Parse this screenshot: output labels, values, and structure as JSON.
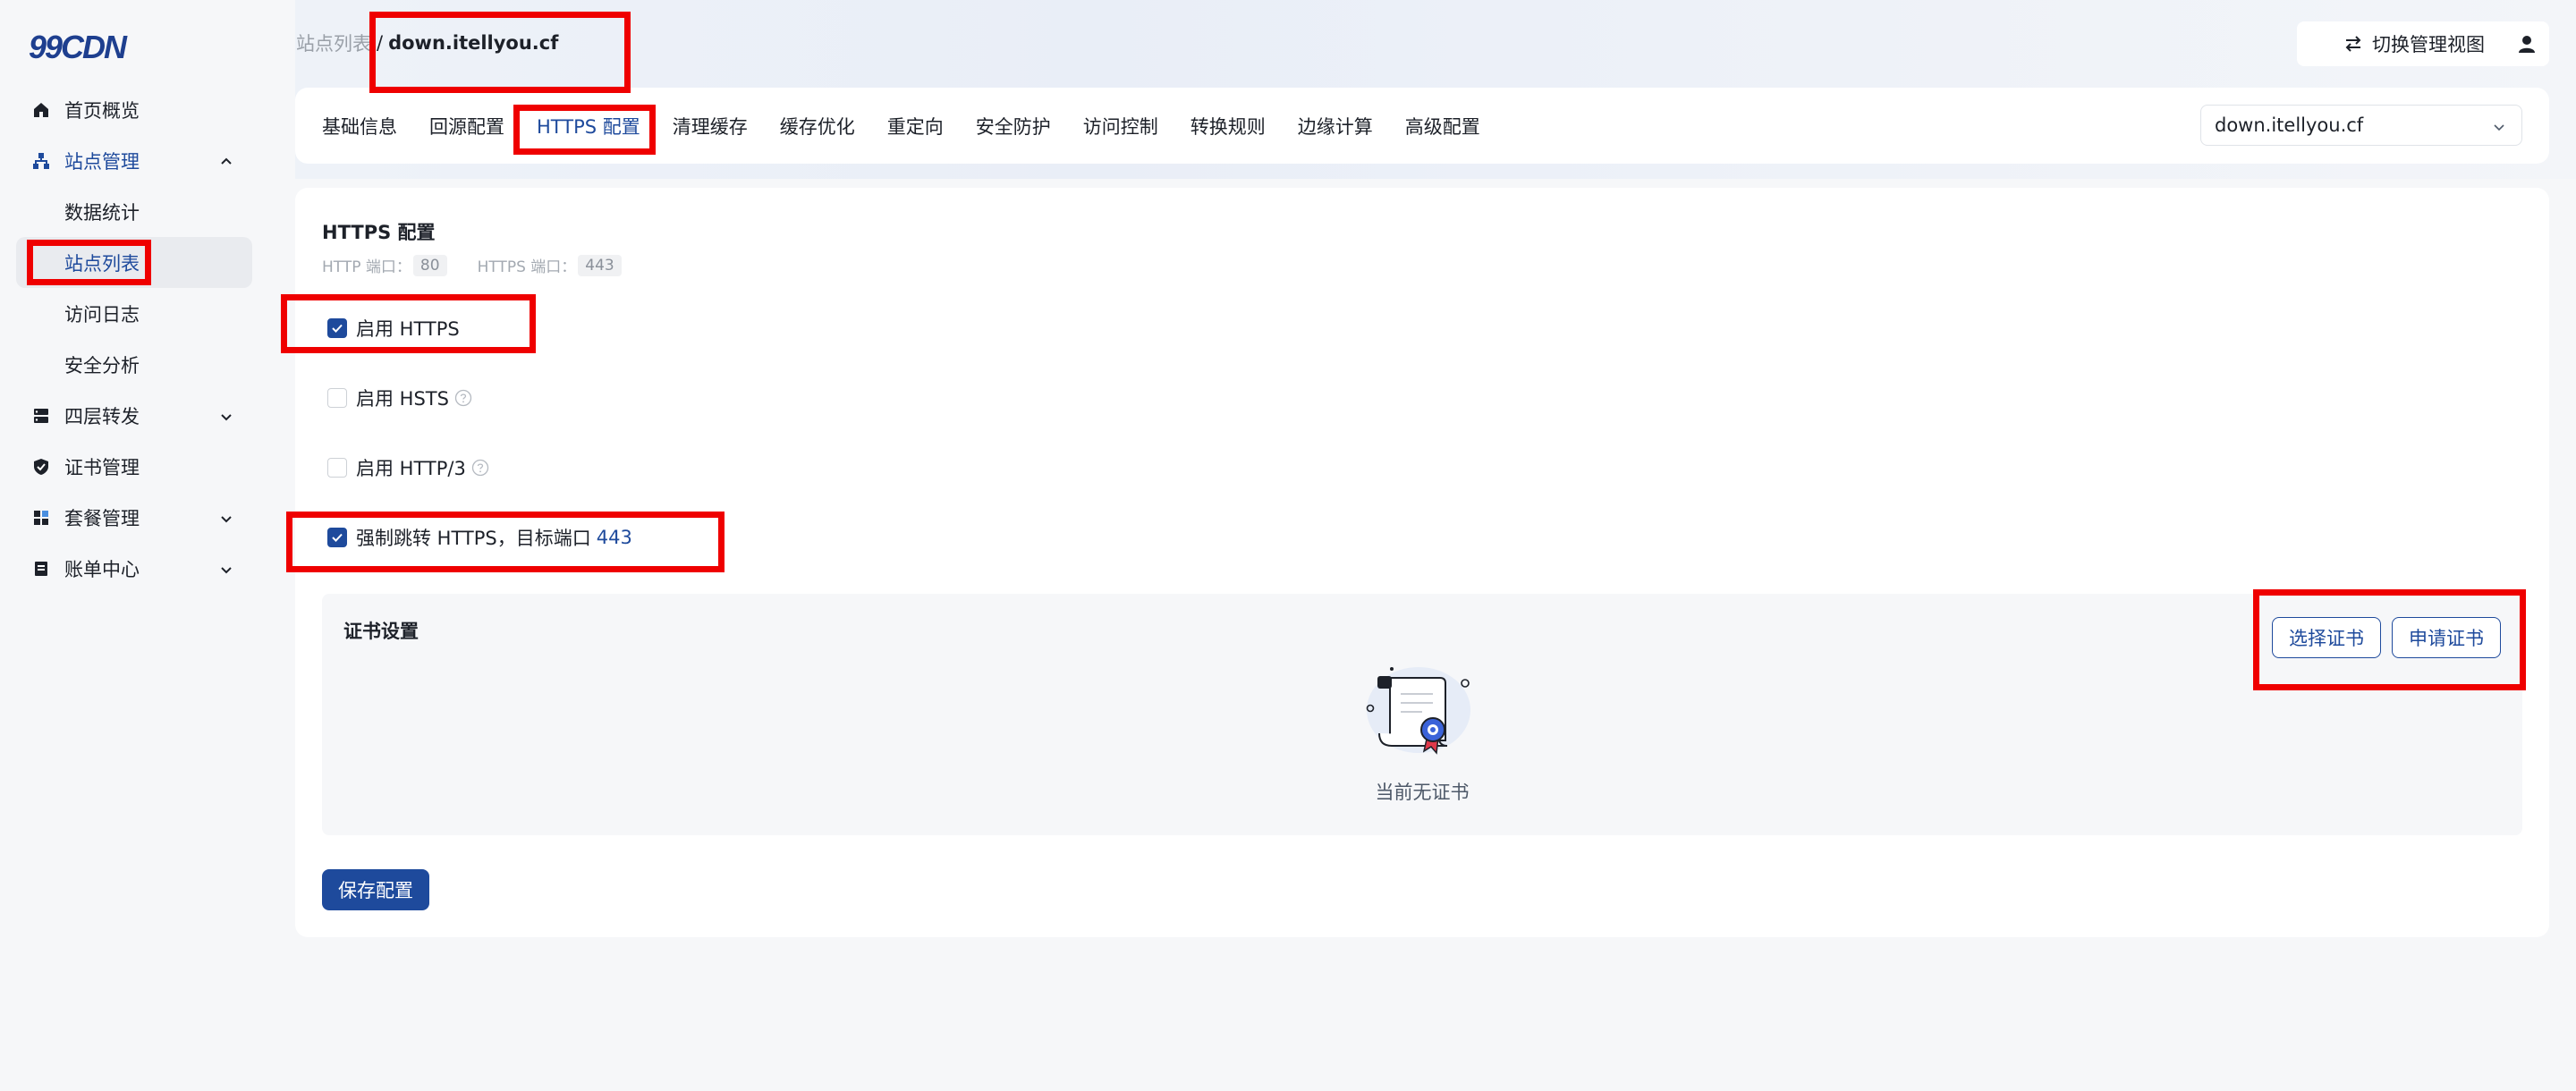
{
  "app": {
    "logo_text": "99CDN"
  },
  "sidebar": {
    "items": [
      {
        "label": "首页概览",
        "icon": "home-icon"
      },
      {
        "label": "站点管理",
        "icon": "sitemap-icon",
        "expanded": true
      },
      {
        "label": "数据统计"
      },
      {
        "label": "站点列表",
        "selected": true
      },
      {
        "label": "访问日志"
      },
      {
        "label": "安全分析"
      },
      {
        "label": "四层转发",
        "icon": "server-icon"
      },
      {
        "label": "证书管理",
        "icon": "shield-icon"
      },
      {
        "label": "套餐管理",
        "icon": "grid-icon"
      },
      {
        "label": "账单中心",
        "icon": "bill-icon"
      }
    ]
  },
  "header": {
    "breadcrumb_root": "站点列表",
    "breadcrumb_sep": "/",
    "breadcrumb_current": "down.itellyou.cf",
    "switch_view_label": "切换管理视图"
  },
  "tabs": [
    {
      "label": "基础信息"
    },
    {
      "label": "回源配置"
    },
    {
      "label": "HTTPS 配置",
      "active": true
    },
    {
      "label": "清理缓存"
    },
    {
      "label": "缓存优化"
    },
    {
      "label": "重定向"
    },
    {
      "label": "安全防护"
    },
    {
      "label": "访问控制"
    },
    {
      "label": "转换规则"
    },
    {
      "label": "边缘计算"
    },
    {
      "label": "高级配置"
    }
  ],
  "site_select": {
    "value": "down.itellyou.cf"
  },
  "https": {
    "title": "HTTPS 配置",
    "http_port_label": "HTTP 端口：",
    "http_port": "80",
    "https_port_label": "HTTPS 端口：",
    "https_port": "443",
    "enable_https": {
      "label": "启用 HTTPS",
      "checked": true
    },
    "enable_hsts": {
      "label": "启用 HSTS",
      "checked": false
    },
    "enable_http3": {
      "label": "启用 HTTP/3",
      "checked": false
    },
    "force_redirect": {
      "label": "强制跳转 HTTPS，目标端口",
      "port": "443",
      "checked": true
    }
  },
  "cert": {
    "title": "证书设置",
    "select_label": "选择证书",
    "apply_label": "申请证书",
    "empty_text": "当前无证书"
  },
  "save_label": "保存配置",
  "colors": {
    "accent": "#1e4a9c",
    "highlight": "#ef0000"
  }
}
